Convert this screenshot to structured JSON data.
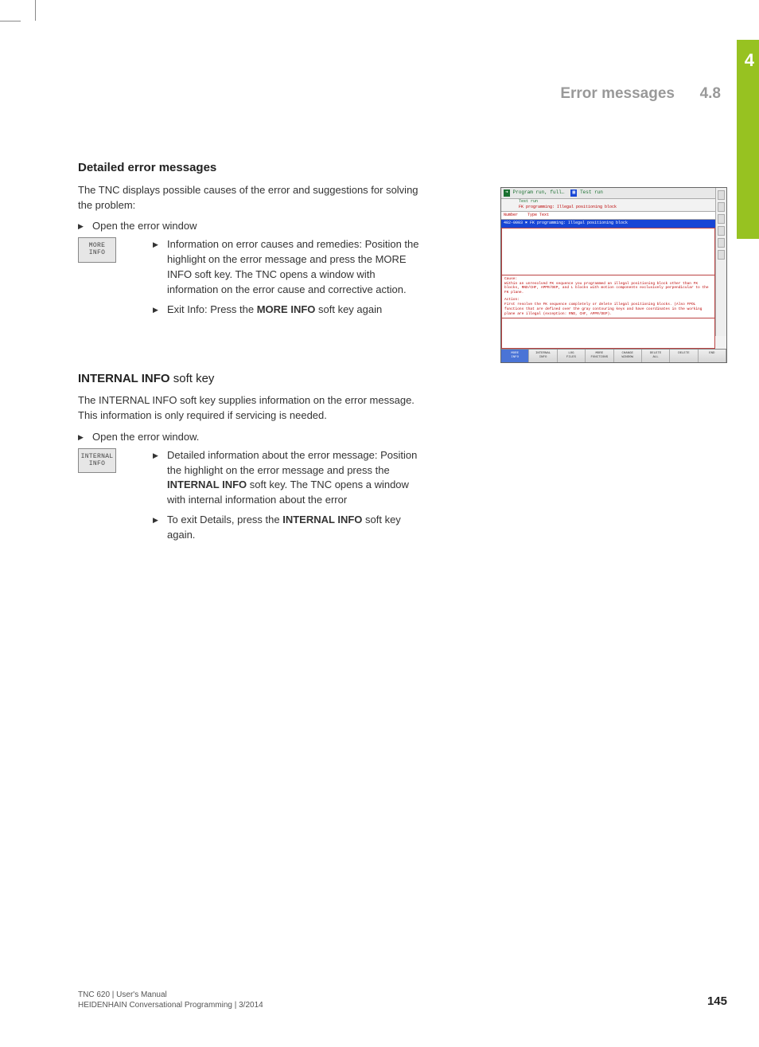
{
  "chapter": {
    "number": "4"
  },
  "header": {
    "title": "Error messages",
    "section": "4.8"
  },
  "section1": {
    "heading": "Detailed error messages",
    "intro": "The TNC displays possible causes of the error and suggestions for solving the problem:",
    "bullet1": "Open the error window",
    "softkey": {
      "line1": "MORE",
      "line2": "INFO"
    },
    "sub1": "Information on error causes and remedies: Position the highlight on the error message and press the MORE INFO soft key. The TNC opens a window with information on the error cause and corrective action.",
    "sub2_pre": "Exit Info: Press the ",
    "sub2_bold": "MORE INFO",
    "sub2_post": " soft key again"
  },
  "section2": {
    "heading_pre": "INTERNAL INFO",
    "heading_post": " soft key",
    "intro": "The INTERNAL INFO soft key supplies information on the error message. This information is only required if servicing is needed.",
    "bullet1": "Open the error window.",
    "softkey": {
      "line1": "INTERNAL",
      "line2": "INFO"
    },
    "sub1_pre": "Detailed information about the error message: Position the highlight on the error message and press the ",
    "sub1_bold": "INTERNAL INFO",
    "sub1_post": " soft key. The TNC opens a window with internal information about the error",
    "sub2_pre": "To exit Details, press the ",
    "sub2_bold": "INTERNAL INFO",
    "sub2_post": " soft key again."
  },
  "screenshot": {
    "title_left": "Program run, full…",
    "title_right": "Test run",
    "title_sub1": "Test run",
    "title_sub2": "FK programming: Illegal positioning block",
    "col1": "Number",
    "col2": "Type Text",
    "sel_row": "402-0003   ✖  FK programming: Illegal positioning block",
    "cause_label": "Cause:",
    "cause_text": "Within an unresolved FK sequence you programmed an illegal positioning block other than FK blocks, RND/CHF, APPR/DEP, and L blocks with motion components exclusively perpendicular to the FK plane.",
    "action_label": "Action:",
    "action_text": "First resolve the FK sequence completely or delete illegal positioning blocks. (Also FPOL functions that are defined over the gray contouring keys and have coordinates in the working plane are illegal (exception: RND, CHF, APPR/DEP).",
    "softkeys": [
      "MORE\nINFO",
      "INTERNAL\nINFO",
      "LOG\nFILES",
      "MORE\nFUNCTIONS",
      "CHANGE\nWINDOW",
      "DELETE\nALL",
      "DELETE",
      "END"
    ]
  },
  "footer": {
    "line1": "TNC 620 | User's Manual",
    "line2": "HEIDENHAIN Conversational Programming | 3/2014",
    "page": "145"
  }
}
